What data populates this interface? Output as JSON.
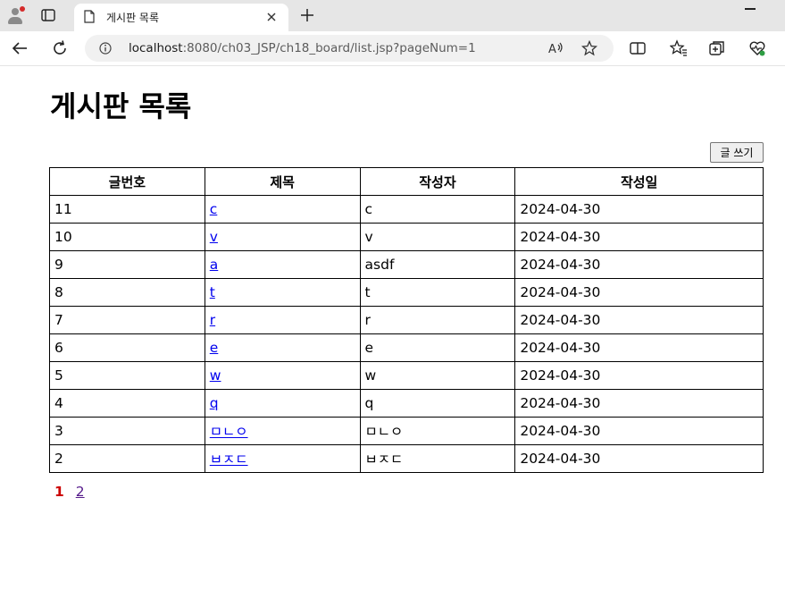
{
  "browser": {
    "tab_title": "게시판 목록",
    "url_host": "localhost",
    "url_rest": ":8080/ch03_JSP/ch18_board/list.jsp?pageNum=1",
    "read_aloud_label": "A)",
    "accent_color": "#d52b2b"
  },
  "page": {
    "title": "게시판 목록",
    "write_button": "글 쓰기"
  },
  "table": {
    "headers": [
      "글번호",
      "제목",
      "작성자",
      "작성일"
    ],
    "rows": [
      {
        "num": "11",
        "title": "c",
        "writer": "c",
        "date": "2024-04-30"
      },
      {
        "num": "10",
        "title": "v",
        "writer": "v",
        "date": "2024-04-30"
      },
      {
        "num": "9",
        "title": "a",
        "writer": "asdf",
        "date": "2024-04-30"
      },
      {
        "num": "8",
        "title": "t",
        "writer": "t",
        "date": "2024-04-30"
      },
      {
        "num": "7",
        "title": "r",
        "writer": "r",
        "date": "2024-04-30"
      },
      {
        "num": "6",
        "title": "e",
        "writer": "e",
        "date": "2024-04-30"
      },
      {
        "num": "5",
        "title": "w",
        "writer": "w",
        "date": "2024-04-30"
      },
      {
        "num": "4",
        "title": "q",
        "writer": "q",
        "date": "2024-04-30"
      },
      {
        "num": "3",
        "title": "ㅁㄴㅇ",
        "writer": "ㅁㄴㅇ",
        "date": "2024-04-30"
      },
      {
        "num": "2",
        "title": "ㅂㅈㄷ",
        "writer": "ㅂㅈㄷ",
        "date": "2024-04-30"
      }
    ]
  },
  "pager": {
    "current": "1",
    "pages": [
      "2"
    ]
  }
}
